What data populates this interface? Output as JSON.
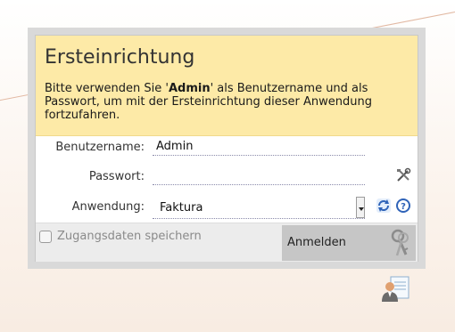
{
  "dialog": {
    "title": "Ersteinrichtung",
    "desc_prefix": "Bitte verwenden Sie '",
    "desc_user": "Admin",
    "desc_suffix": "' als Benutzername und als Passwort, um mit der Ersteinrichtung dieser Anwendung fortzufahren."
  },
  "form": {
    "username_label": "Benutzername:",
    "username_value": "Admin",
    "password_label": "Passwort:",
    "password_value": "",
    "application_label": "Anwendung:",
    "application_value": "Faktura"
  },
  "footer": {
    "remember_label": "Zugangsdaten speichern",
    "login_label": "Anmelden"
  },
  "icons": {
    "tools": "tools-icon",
    "refresh": "refresh-icon",
    "help": "help-icon",
    "keys": "keys-icon",
    "user_card": "user-card-icon"
  },
  "colors": {
    "banner": "#fdeaa7",
    "accent": "#2f63b8",
    "button": "#c6c6c6"
  }
}
